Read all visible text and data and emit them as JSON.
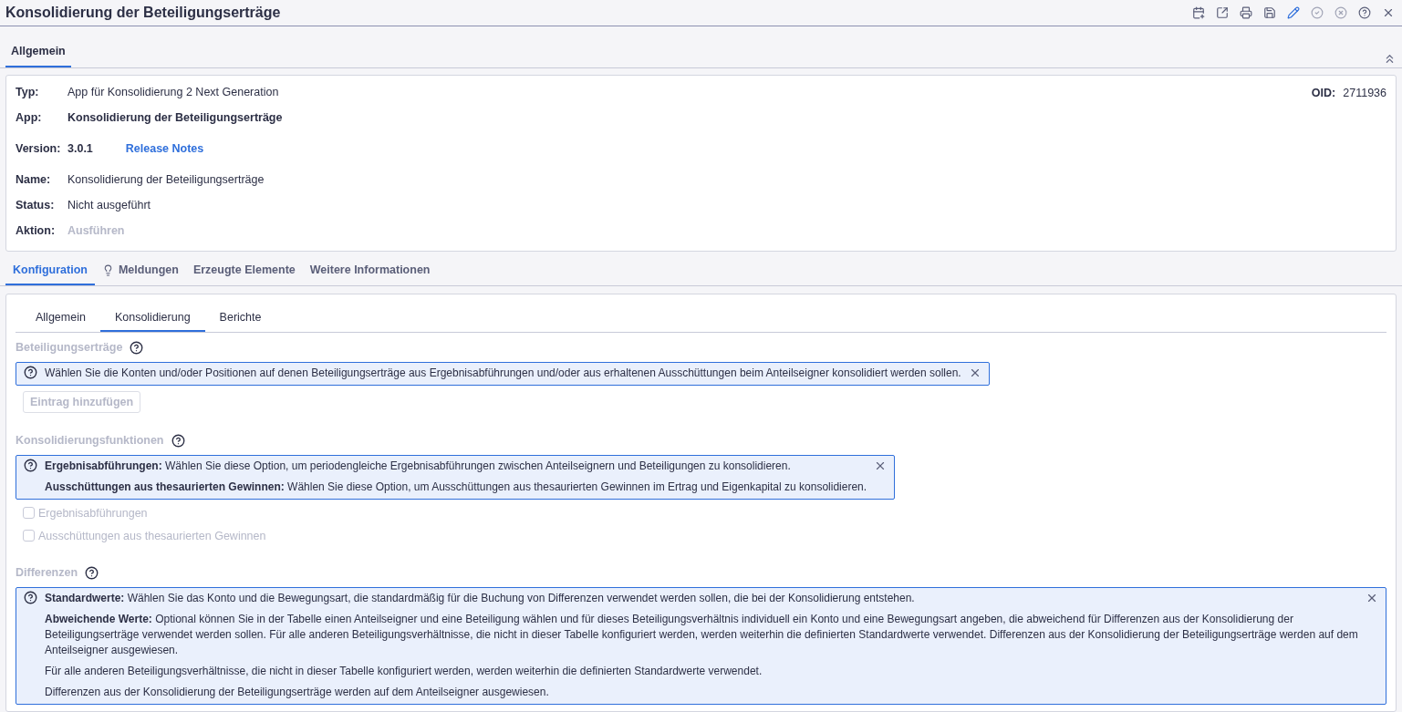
{
  "window": {
    "title": "Konsolidierung der Beteiligungserträge"
  },
  "top_tabs": [
    {
      "label": "Allgemein",
      "selected": true
    }
  ],
  "info": {
    "rows": [
      {
        "label": "Typ:",
        "value": "App für Konsolidierung 2 Next Generation",
        "kind": "text"
      },
      {
        "label": "App:",
        "value": "Konsolidierung der Beteiligungserträge",
        "kind": "bold"
      },
      {
        "label": "Version:",
        "value": "3.0.1",
        "kind": "bold",
        "link": "Release Notes"
      },
      {
        "label": "Name:",
        "value": "Konsolidierung der Beteiligungserträge",
        "kind": "text"
      },
      {
        "label": "Status:",
        "value": "Nicht ausgeführt",
        "kind": "text"
      },
      {
        "label": "Aktion:",
        "value": "Ausführen",
        "kind": "disabled"
      }
    ],
    "oid": {
      "label": "OID:",
      "value": "2711936"
    }
  },
  "main_tabs": [
    {
      "label": "Konfiguration",
      "selected": true,
      "kind": "plain"
    },
    {
      "label": "Meldungen",
      "selected": false,
      "kind": "bulb"
    },
    {
      "label": "Erzeugte Elemente",
      "selected": false,
      "kind": "plain"
    },
    {
      "label": "Weitere Informationen",
      "selected": false,
      "kind": "plain"
    }
  ],
  "sub_tabs": [
    {
      "label": "Allgemein",
      "selected": false
    },
    {
      "label": "Konsolidierung",
      "selected": true
    },
    {
      "label": "Berichte",
      "selected": false
    }
  ],
  "sections": [
    {
      "title": "Beteiligungserträge",
      "kind": "entries",
      "hint": [
        "Wählen Sie die Konten und/oder Positionen auf denen Beteiligungserträge aus Ergebnisabführungen und/oder aus erhaltenen Ausschüttungen beim Anteilseigner konsolidiert werden sollen."
      ],
      "button": {
        "label": "Eintrag hinzufügen",
        "disabled": true
      }
    },
    {
      "title": "Konsolidierungsfunktionen",
      "kind": "options",
      "hint": [
        "**Ergebnisabführungen:** Wählen Sie diese Option, um periodengleiche Ergebnisabführungen zwischen Anteilseignern und Beteiligungen zu konsolidieren.",
        "**Ausschüttungen aus thesaurierten Gewinnen:** Wählen Sie diese Option, um Ausschüttungen aus thesaurierten Gewinnen im Ertrag und Eigenkapital zu konsolidieren."
      ],
      "options": [
        {
          "label": "Ergebnisabführungen",
          "checked": false,
          "disabled": true
        },
        {
          "label": "Ausschüttungen aus thesaurierten Gewinnen",
          "checked": false,
          "disabled": true
        }
      ]
    },
    {
      "title": "Differenzen",
      "kind": "wide",
      "hint": [
        "**Standardwerte:** Wählen Sie das Konto und die Bewegungsart, die standardmäßig für die Buchung von Differenzen verwendet werden sollen, die bei der Konsolidierung entstehen.",
        "**Abweichende Werte:** Optional können Sie in der Tabelle einen Anteilseigner und eine Beteiligung wählen und für dieses Beteiligungsverhältnis individuell ein Konto und eine Bewegungsart angeben, die abweichend für Differenzen aus der Konsolidierung der Beteiligungserträge verwendet werden sollen. Für alle anderen Beteiligungsverhältnisse, die nicht in dieser Tabelle konfiguriert werden, werden weiterhin die definierten Standardwerte verwendet. Differenzen aus der Konsolidierung der Beteiligungserträge werden auf dem Anteilseigner ausgewiesen.",
        "Für alle anderen Beteiligungsverhältnisse, die nicht in dieser Tabelle konfiguriert werden, werden weiterhin die definierten Standardwerte verwendet.",
        "Differenzen aus der Konsolidierung der Beteiligungserträge werden auf dem Anteilseigner ausgewiesen."
      ]
    }
  ]
}
